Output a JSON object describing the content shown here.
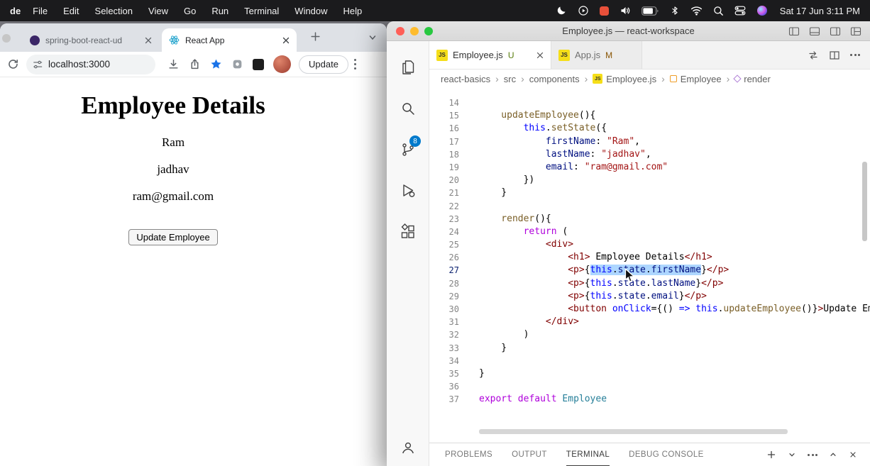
{
  "menubar": {
    "app": "de",
    "items": [
      "File",
      "Edit",
      "Selection",
      "View",
      "Go",
      "Run",
      "Terminal",
      "Window",
      "Help"
    ],
    "clock": "Sat 17 Jun 3:11 PM"
  },
  "browser": {
    "tabs": [
      {
        "title": "spring-boot-react-ud",
        "active": false
      },
      {
        "title": "React App",
        "active": true
      }
    ],
    "address": "localhost:3000",
    "update_label": "Update",
    "page": {
      "heading": "Employee Details",
      "fields": [
        "Ram",
        "jadhav",
        "ram@gmail.com"
      ],
      "button_label": "Update Employee"
    }
  },
  "vscode": {
    "window_title": "Employee.js — react-workspace",
    "js_icon_label": "JS",
    "editor_tabs": [
      {
        "label": "Employee.js",
        "badge": "U",
        "active": true
      },
      {
        "label": "App.js",
        "badge": "M",
        "active": false
      }
    ],
    "breadcrumbs": [
      {
        "label": "react-basics"
      },
      {
        "label": "src"
      },
      {
        "label": "components"
      },
      {
        "label": "Employee.js",
        "icon": "js"
      },
      {
        "label": "Employee",
        "icon": "class"
      },
      {
        "label": "render",
        "icon": "method"
      }
    ],
    "activity_badge": "8",
    "code_lines": [
      {
        "n": 14,
        "i": 0,
        "s": []
      },
      {
        "n": 15,
        "i": 1,
        "s": [
          {
            "t": "updateEmployee",
            "c": "fn"
          },
          {
            "t": "(){",
            "c": "pun"
          }
        ]
      },
      {
        "n": 16,
        "i": 2,
        "s": [
          {
            "t": "this",
            "c": "kw"
          },
          {
            "t": ".",
            "c": "pun"
          },
          {
            "t": "setState",
            "c": "fn"
          },
          {
            "t": "({",
            "c": "pun"
          }
        ]
      },
      {
        "n": 17,
        "i": 3,
        "s": [
          {
            "t": "firstName",
            "c": "var"
          },
          {
            "t": ": ",
            "c": "pun"
          },
          {
            "t": "\"Ram\"",
            "c": "str"
          },
          {
            "t": ",",
            "c": "pun"
          }
        ]
      },
      {
        "n": 18,
        "i": 3,
        "s": [
          {
            "t": "lastName",
            "c": "var"
          },
          {
            "t": ": ",
            "c": "pun"
          },
          {
            "t": "\"jadhav\"",
            "c": "str"
          },
          {
            "t": ",",
            "c": "pun"
          }
        ]
      },
      {
        "n": 19,
        "i": 3,
        "s": [
          {
            "t": "email",
            "c": "var"
          },
          {
            "t": ": ",
            "c": "pun"
          },
          {
            "t": "\"ram@gmail.com\"",
            "c": "str"
          }
        ]
      },
      {
        "n": 20,
        "i": 2,
        "s": [
          {
            "t": "})",
            "c": "pun"
          }
        ]
      },
      {
        "n": 21,
        "i": 1,
        "s": [
          {
            "t": "}",
            "c": "pun"
          }
        ]
      },
      {
        "n": 22,
        "i": 0,
        "s": []
      },
      {
        "n": 23,
        "i": 1,
        "s": [
          {
            "t": "render",
            "c": "fn"
          },
          {
            "t": "(){",
            "c": "pun"
          }
        ]
      },
      {
        "n": 24,
        "i": 2,
        "s": [
          {
            "t": "return",
            "c": "ctl"
          },
          {
            "t": " (",
            "c": "pun"
          }
        ]
      },
      {
        "n": 25,
        "i": 3,
        "s": [
          {
            "t": "<div>",
            "c": "tag"
          }
        ]
      },
      {
        "n": 26,
        "i": 4,
        "s": [
          {
            "t": "<h1>",
            "c": "tag"
          },
          {
            "t": " Employee Details",
            "c": "txt"
          },
          {
            "t": "</h1>",
            "c": "tag"
          }
        ]
      },
      {
        "n": 27,
        "i": 4,
        "a": 1,
        "s": [
          {
            "t": "<p>",
            "c": "tag"
          },
          {
            "t": "{",
            "c": "pun"
          },
          {
            "t": "this",
            "c": "kw",
            "sel": 1
          },
          {
            "t": ".",
            "c": "pun",
            "sel": 1
          },
          {
            "t": "state",
            "c": "var",
            "sel": 1
          },
          {
            "t": ".",
            "c": "pun",
            "sel": 1
          },
          {
            "t": "firstName",
            "c": "var",
            "sel": 1
          },
          {
            "t": "}",
            "c": "pun"
          },
          {
            "t": "</p>",
            "c": "tag"
          }
        ]
      },
      {
        "n": 28,
        "i": 4,
        "s": [
          {
            "t": "<p>",
            "c": "tag"
          },
          {
            "t": "{",
            "c": "pun"
          },
          {
            "t": "this",
            "c": "kw"
          },
          {
            "t": ".",
            "c": "pun"
          },
          {
            "t": "state",
            "c": "var"
          },
          {
            "t": ".",
            "c": "pun"
          },
          {
            "t": "lastName",
            "c": "var"
          },
          {
            "t": "}",
            "c": "pun"
          },
          {
            "t": "</p>",
            "c": "tag"
          }
        ]
      },
      {
        "n": 29,
        "i": 4,
        "s": [
          {
            "t": "<p>",
            "c": "tag"
          },
          {
            "t": "{",
            "c": "pun"
          },
          {
            "t": "this",
            "c": "kw"
          },
          {
            "t": ".",
            "c": "pun"
          },
          {
            "t": "state",
            "c": "var"
          },
          {
            "t": ".",
            "c": "pun"
          },
          {
            "t": "email",
            "c": "var"
          },
          {
            "t": "}",
            "c": "pun"
          },
          {
            "t": "</p>",
            "c": "tag"
          }
        ]
      },
      {
        "n": 30,
        "i": 4,
        "s": [
          {
            "t": "<button ",
            "c": "tag"
          },
          {
            "t": "onClick",
            "c": "attr"
          },
          {
            "t": "={() ",
            "c": "pun"
          },
          {
            "t": "=>",
            "c": "kw"
          },
          {
            "t": " ",
            "c": "pun"
          },
          {
            "t": "this",
            "c": "kw"
          },
          {
            "t": ".",
            "c": "pun"
          },
          {
            "t": "updateEmployee",
            "c": "fn"
          },
          {
            "t": "()}",
            "c": "pun"
          },
          {
            "t": ">",
            "c": "tag"
          },
          {
            "t": "Update Employ",
            "c": "txt"
          }
        ]
      },
      {
        "n": 31,
        "i": 3,
        "s": [
          {
            "t": "</div>",
            "c": "tag"
          }
        ]
      },
      {
        "n": 32,
        "i": 2,
        "s": [
          {
            "t": ")",
            "c": "pun"
          }
        ]
      },
      {
        "n": 33,
        "i": 1,
        "s": [
          {
            "t": "}",
            "c": "pun"
          }
        ]
      },
      {
        "n": 34,
        "i": 0,
        "s": []
      },
      {
        "n": 35,
        "i": 0,
        "s": [
          {
            "t": "}",
            "c": "pun"
          }
        ]
      },
      {
        "n": 36,
        "i": 0,
        "s": []
      },
      {
        "n": 37,
        "i": 0,
        "s": [
          {
            "t": "export",
            "c": "ctl"
          },
          {
            "t": " ",
            "c": "pun"
          },
          {
            "t": "default",
            "c": "ctl"
          },
          {
            "t": " ",
            "c": "pun"
          },
          {
            "t": "Employee",
            "c": "cls"
          }
        ]
      }
    ],
    "panel": {
      "tabs": [
        "PROBLEMS",
        "OUTPUT",
        "TERMINAL",
        "DEBUG CONSOLE"
      ],
      "active_tab": "TERMINAL"
    }
  }
}
